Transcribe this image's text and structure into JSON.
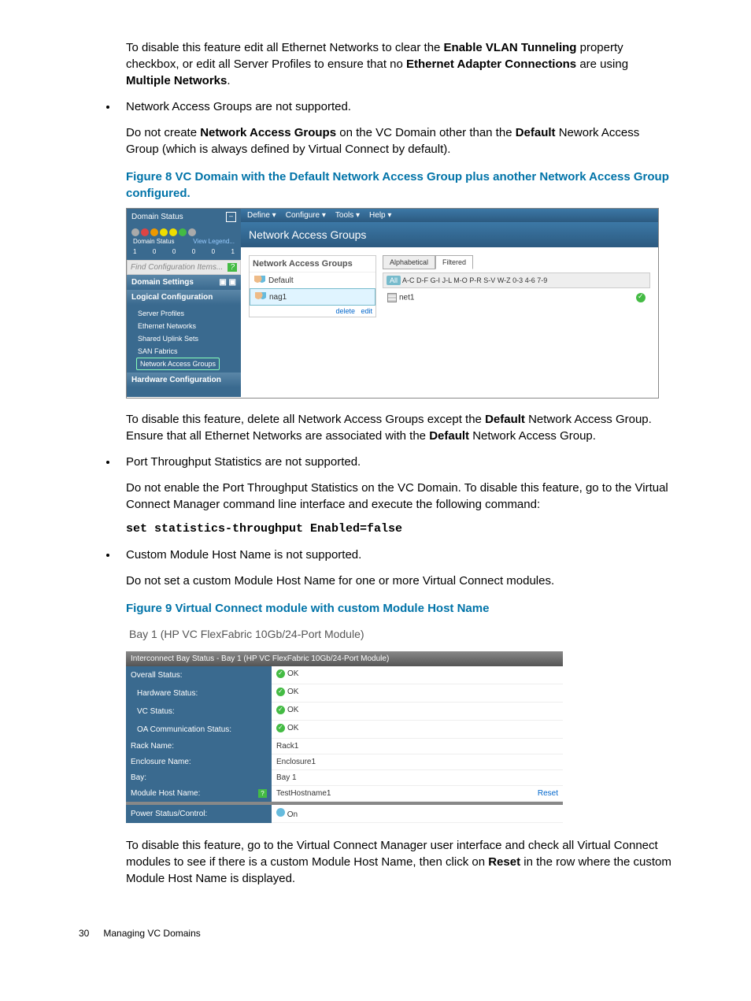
{
  "para1_pre": "To disable this feature edit all Ethernet Networks to clear the ",
  "para1_b1": "Enable VLAN Tunneling",
  "para1_mid": " property checkbox, or edit all Server Profiles to ensure that no ",
  "para1_b2": "Ethernet Adapter Connections",
  "para1_mid2": " are using ",
  "para1_b3": "Multiple Networks",
  "bullet1": "Network Access Groups are not supported.",
  "para2_pre": "Do not create ",
  "para2_b1": "Network Access Groups",
  "para2_mid": " on the VC Domain other than the ",
  "para2_b2": "Default",
  "para2_post": " Nework Access Group (which is always defined by Virtual Connect by default).",
  "fig8_caption": "Figure 8 VC Domain with the Default Network Access Group plus another Network Access Group configured.",
  "fig8": {
    "domain_status": "Domain Status",
    "status_label_domain": "Domain Status",
    "view_legend": "View Legend...",
    "counts": [
      "1",
      "0",
      "0",
      "0",
      "0",
      "1"
    ],
    "find": "Find Configuration Items...",
    "domain_settings": "Domain Settings",
    "logical_config": "Logical Configuration",
    "items": [
      "Server Profiles",
      "Ethernet Networks",
      "Shared Uplink Sets",
      "SAN Fabrics",
      "Network Access Groups"
    ],
    "hardware_config": "Hardware Configuration",
    "menu": [
      "Define ▾",
      "Configure ▾",
      "Tools ▾",
      "Help ▾"
    ],
    "page_title": "Network Access Groups",
    "tree_title": "Network Access Groups",
    "tree_default": "Default",
    "tree_nag1": "nag1",
    "tree_delete": "delete",
    "tree_edit": "edit",
    "tab_alpha": "Alphabetical",
    "tab_filter": "Filtered",
    "filters": [
      "All",
      "A-C",
      "D-F",
      "G-I",
      "J-L",
      "M-O",
      "P-R",
      "S-V",
      "W-Z",
      "0-3",
      "4-6",
      "7-9"
    ],
    "net1": "net1"
  },
  "para3_pre": "To disable this feature, delete all Network Access Groups except the ",
  "para3_b1": "Default",
  "para3_mid": " Network Access Group. Ensure that all Ethernet Networks are associated with the ",
  "para3_b2": "Default",
  "para3_post": " Network Access Group.",
  "bullet2": "Port Throughput Statistics are not supported.",
  "para4": "Do not enable the Port Throughput Statistics on the VC Domain. To disable this feature, go to the Virtual Connect Manager command line interface and execute the following command:",
  "command": "set statistics-throughput Enabled=false",
  "bullet3": "Custom Module Host Name is not supported.",
  "para5": "Do not set a custom Module Host Name for one or more Virtual Connect modules.",
  "fig9_caption": "Figure 9 Virtual Connect module with custom Module Host Name",
  "fig9": {
    "title": "Bay 1 (HP VC FlexFabric 10Gb/24-Port Module)",
    "header": "Interconnect Bay Status - Bay 1 (HP VC FlexFabric 10Gb/24-Port Module)",
    "overall": "Overall Status:",
    "hw": "Hardware Status:",
    "vc": "VC Status:",
    "oa": "OA Communication Status:",
    "rack": "Rack Name:",
    "rackv": "Rack1",
    "enc": "Enclosure Name:",
    "encv": "Enclosure1",
    "bay": "Bay:",
    "bayv": "Bay 1",
    "mhn": "Module Host Name:",
    "mhnv": "TestHostname1",
    "reset": "Reset",
    "psc": "Power Status/Control:",
    "on": "On",
    "ok": "OK"
  },
  "para6_pre": "To disable this feature, go to the Virtual Connect Manager user interface and check all Virtual Connect modules to see if there is a custom Module Host Name, then click on ",
  "para6_b1": "Reset",
  "para6_post": " in the row where the custom Module Host Name is displayed.",
  "footer_page": "30",
  "footer_title": "Managing VC Domains"
}
